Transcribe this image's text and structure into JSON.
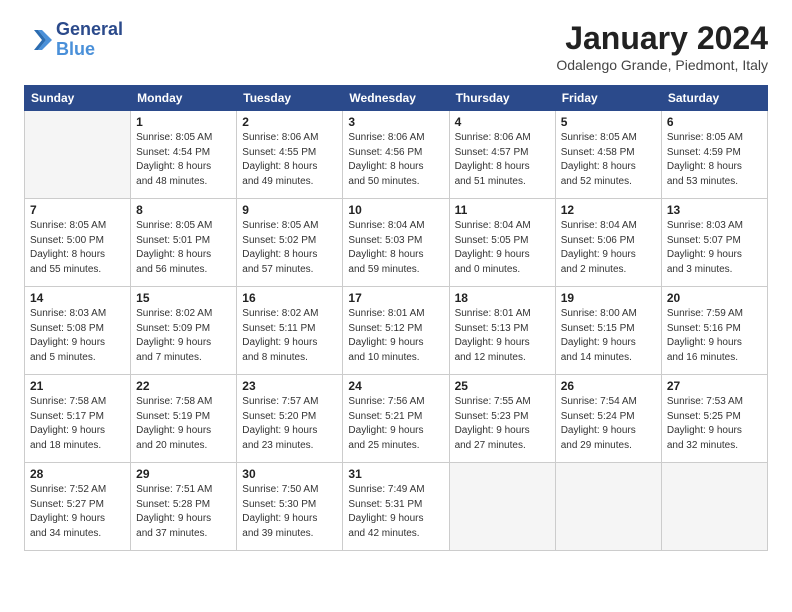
{
  "logo": {
    "line1": "General",
    "line2": "Blue"
  },
  "title": "January 2024",
  "subtitle": "Odalengo Grande, Piedmont, Italy",
  "weekdays": [
    "Sunday",
    "Monday",
    "Tuesday",
    "Wednesday",
    "Thursday",
    "Friday",
    "Saturday"
  ],
  "weeks": [
    [
      {
        "day": "",
        "info": ""
      },
      {
        "day": "1",
        "info": "Sunrise: 8:05 AM\nSunset: 4:54 PM\nDaylight: 8 hours\nand 48 minutes."
      },
      {
        "day": "2",
        "info": "Sunrise: 8:06 AM\nSunset: 4:55 PM\nDaylight: 8 hours\nand 49 minutes."
      },
      {
        "day": "3",
        "info": "Sunrise: 8:06 AM\nSunset: 4:56 PM\nDaylight: 8 hours\nand 50 minutes."
      },
      {
        "day": "4",
        "info": "Sunrise: 8:06 AM\nSunset: 4:57 PM\nDaylight: 8 hours\nand 51 minutes."
      },
      {
        "day": "5",
        "info": "Sunrise: 8:05 AM\nSunset: 4:58 PM\nDaylight: 8 hours\nand 52 minutes."
      },
      {
        "day": "6",
        "info": "Sunrise: 8:05 AM\nSunset: 4:59 PM\nDaylight: 8 hours\nand 53 minutes."
      }
    ],
    [
      {
        "day": "7",
        "info": "Sunrise: 8:05 AM\nSunset: 5:00 PM\nDaylight: 8 hours\nand 55 minutes."
      },
      {
        "day": "8",
        "info": "Sunrise: 8:05 AM\nSunset: 5:01 PM\nDaylight: 8 hours\nand 56 minutes."
      },
      {
        "day": "9",
        "info": "Sunrise: 8:05 AM\nSunset: 5:02 PM\nDaylight: 8 hours\nand 57 minutes."
      },
      {
        "day": "10",
        "info": "Sunrise: 8:04 AM\nSunset: 5:03 PM\nDaylight: 8 hours\nand 59 minutes."
      },
      {
        "day": "11",
        "info": "Sunrise: 8:04 AM\nSunset: 5:05 PM\nDaylight: 9 hours\nand 0 minutes."
      },
      {
        "day": "12",
        "info": "Sunrise: 8:04 AM\nSunset: 5:06 PM\nDaylight: 9 hours\nand 2 minutes."
      },
      {
        "day": "13",
        "info": "Sunrise: 8:03 AM\nSunset: 5:07 PM\nDaylight: 9 hours\nand 3 minutes."
      }
    ],
    [
      {
        "day": "14",
        "info": "Sunrise: 8:03 AM\nSunset: 5:08 PM\nDaylight: 9 hours\nand 5 minutes."
      },
      {
        "day": "15",
        "info": "Sunrise: 8:02 AM\nSunset: 5:09 PM\nDaylight: 9 hours\nand 7 minutes."
      },
      {
        "day": "16",
        "info": "Sunrise: 8:02 AM\nSunset: 5:11 PM\nDaylight: 9 hours\nand 8 minutes."
      },
      {
        "day": "17",
        "info": "Sunrise: 8:01 AM\nSunset: 5:12 PM\nDaylight: 9 hours\nand 10 minutes."
      },
      {
        "day": "18",
        "info": "Sunrise: 8:01 AM\nSunset: 5:13 PM\nDaylight: 9 hours\nand 12 minutes."
      },
      {
        "day": "19",
        "info": "Sunrise: 8:00 AM\nSunset: 5:15 PM\nDaylight: 9 hours\nand 14 minutes."
      },
      {
        "day": "20",
        "info": "Sunrise: 7:59 AM\nSunset: 5:16 PM\nDaylight: 9 hours\nand 16 minutes."
      }
    ],
    [
      {
        "day": "21",
        "info": "Sunrise: 7:58 AM\nSunset: 5:17 PM\nDaylight: 9 hours\nand 18 minutes."
      },
      {
        "day": "22",
        "info": "Sunrise: 7:58 AM\nSunset: 5:19 PM\nDaylight: 9 hours\nand 20 minutes."
      },
      {
        "day": "23",
        "info": "Sunrise: 7:57 AM\nSunset: 5:20 PM\nDaylight: 9 hours\nand 23 minutes."
      },
      {
        "day": "24",
        "info": "Sunrise: 7:56 AM\nSunset: 5:21 PM\nDaylight: 9 hours\nand 25 minutes."
      },
      {
        "day": "25",
        "info": "Sunrise: 7:55 AM\nSunset: 5:23 PM\nDaylight: 9 hours\nand 27 minutes."
      },
      {
        "day": "26",
        "info": "Sunrise: 7:54 AM\nSunset: 5:24 PM\nDaylight: 9 hours\nand 29 minutes."
      },
      {
        "day": "27",
        "info": "Sunrise: 7:53 AM\nSunset: 5:25 PM\nDaylight: 9 hours\nand 32 minutes."
      }
    ],
    [
      {
        "day": "28",
        "info": "Sunrise: 7:52 AM\nSunset: 5:27 PM\nDaylight: 9 hours\nand 34 minutes."
      },
      {
        "day": "29",
        "info": "Sunrise: 7:51 AM\nSunset: 5:28 PM\nDaylight: 9 hours\nand 37 minutes."
      },
      {
        "day": "30",
        "info": "Sunrise: 7:50 AM\nSunset: 5:30 PM\nDaylight: 9 hours\nand 39 minutes."
      },
      {
        "day": "31",
        "info": "Sunrise: 7:49 AM\nSunset: 5:31 PM\nDaylight: 9 hours\nand 42 minutes."
      },
      {
        "day": "",
        "info": ""
      },
      {
        "day": "",
        "info": ""
      },
      {
        "day": "",
        "info": ""
      }
    ]
  ]
}
